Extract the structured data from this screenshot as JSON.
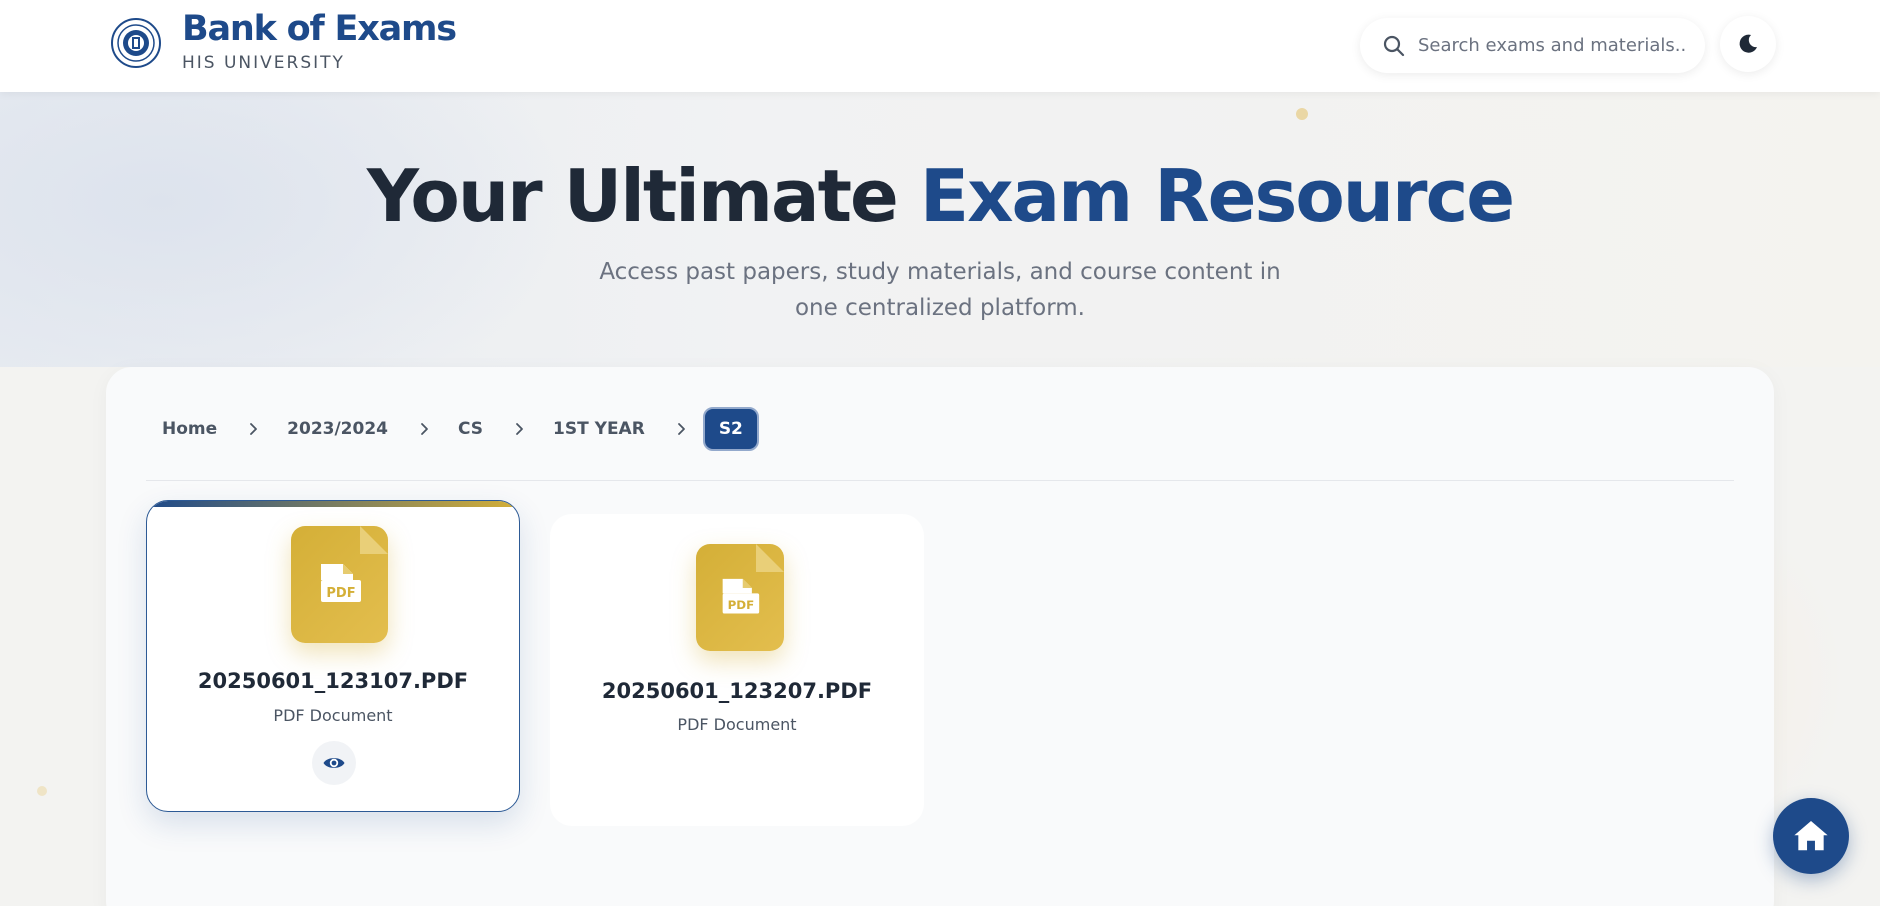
{
  "header": {
    "brand_title": "Bank of Exams",
    "brand_subtitle": "HIS UNIVERSITY",
    "logo_icon": "university-seal-icon",
    "search": {
      "placeholder": "Search exams and materials...",
      "value": "",
      "icon": "search-icon"
    },
    "theme_toggle_icon": "moon-icon"
  },
  "hero": {
    "title_part1": "Your Ultimate ",
    "title_accent": "Exam Resource",
    "subtitle": "Access past papers, study materials, and course content in one centralized platform."
  },
  "breadcrumb": {
    "items": [
      "Home",
      "2023/2024",
      "CS",
      "1ST YEAR"
    ],
    "active": "S2"
  },
  "files": [
    {
      "name": "20250601_123107.PDF",
      "type": "PDF Document",
      "icon": "pdf-file-icon",
      "badge": "PDF"
    },
    {
      "name": "20250601_123207.PDF",
      "type": "PDF Document",
      "icon": "pdf-file-icon",
      "badge": "PDF"
    }
  ],
  "fab": {
    "icon": "home-icon"
  },
  "colors": {
    "primary": "#1e4a8a",
    "accent_gold": "#d4af37",
    "text_dark": "#1f2937",
    "text_muted": "#6b7280"
  }
}
